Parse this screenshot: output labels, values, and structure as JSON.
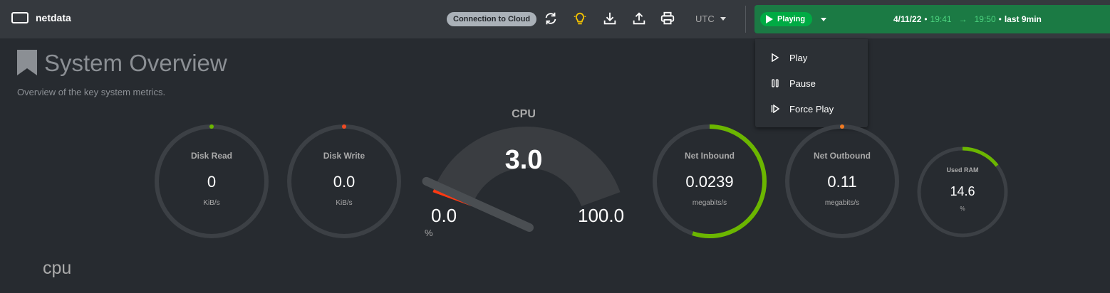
{
  "app": {
    "name": "netdata"
  },
  "toolbar": {
    "cloud_label": "Connection to Cloud",
    "icons": [
      "sync-icon",
      "lightbulb-icon",
      "download-icon",
      "upload-icon",
      "printer-icon"
    ],
    "timezone": "UTC"
  },
  "player": {
    "status": "Playing",
    "date": "4/11/22",
    "start_time": "19:41",
    "end_time": "19:50",
    "duration": "last 9min",
    "colors": {
      "bar": "#1b7a44",
      "pill": "#00ab44"
    }
  },
  "player_menu": {
    "items": [
      {
        "label": "Play",
        "icon": "play-outline-icon"
      },
      {
        "label": "Pause",
        "icon": "pause-icon"
      },
      {
        "label": "Force Play",
        "icon": "force-play-icon"
      }
    ]
  },
  "section": {
    "title": "System Overview",
    "subtitle": "Overview of the key system metrics."
  },
  "gauges": [
    {
      "label": "Disk Read",
      "value": "0",
      "unit": "KiB/s",
      "fraction": 0.0,
      "color": "#6bb600"
    },
    {
      "label": "Disk Write",
      "value": "0.0",
      "unit": "KiB/s",
      "fraction": 0.0,
      "color": "#f04a23"
    },
    {
      "label": "Net Inbound",
      "value": "0.0239",
      "unit": "megabits/s",
      "fraction": 0.55,
      "color": "#6bb600"
    },
    {
      "label": "Net Outbound",
      "value": "0.11",
      "unit": "megabits/s",
      "fraction": 0.0,
      "color": "#f07a23"
    },
    {
      "label": "Used RAM",
      "value": "14.6",
      "unit": "%",
      "fraction": 0.146,
      "color": "#6bb600"
    }
  ],
  "cpu_gauge": {
    "title": "CPU",
    "value": "3.0",
    "min": "0.0",
    "max": "100.0",
    "unit": "%",
    "fraction": 0.03,
    "color": "#fe3912"
  },
  "next_section": {
    "title": "cpu"
  }
}
